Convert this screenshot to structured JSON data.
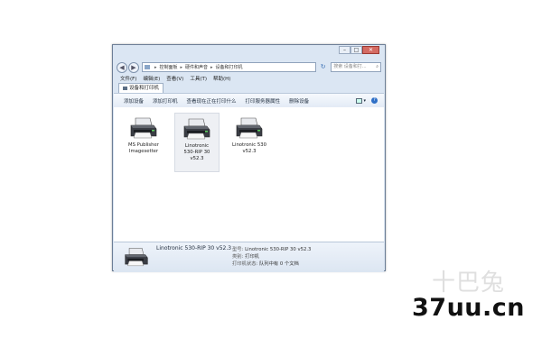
{
  "window": {
    "minimize_glyph": "–",
    "maximize_glyph": "□",
    "close_glyph": "✕"
  },
  "address_bar": {
    "back_glyph": "◀",
    "forward_glyph": "▶",
    "path": [
      "控制面板",
      "硬件和声音",
      "设备和打印机"
    ],
    "separator_glyph": "▸",
    "refresh_glyph": "↻",
    "search_placeholder": "搜索 设备和打...",
    "search_icon": "search-icon"
  },
  "menu": [
    "文件(F)",
    "编辑(E)",
    "查看(V)",
    "工具(T)",
    "帮助(H)"
  ],
  "tab": {
    "label": "设备和打印机"
  },
  "toolbar": {
    "actions": [
      "添加设备",
      "添加打印机",
      "查看现在正在打印什么",
      "打印服务器属性",
      "删除设备"
    ],
    "view_glyph": "▾",
    "help_glyph": "?"
  },
  "devices": [
    {
      "label_lines": [
        "MS Publisher",
        "Imagesetter"
      ],
      "selected": false
    },
    {
      "label_lines": [
        "Linotronic",
        "530-RIP 30",
        "v52.3"
      ],
      "selected": true
    },
    {
      "label_lines": [
        "Linotronic 530",
        "v52.3"
      ],
      "selected": false
    }
  ],
  "details": {
    "name": "Linotronic 530-RIP 30 v52.3",
    "model_key": "型号:",
    "model_value": "Linotronic 530-RIP 30 v52.3",
    "category_key": "类别:",
    "category_value": "打印机",
    "status_key": "打印机状态:",
    "status_value": "队列中有 0 个文档"
  },
  "watermark": {
    "cn": "十巴兔",
    "url": "37uu.cn"
  }
}
